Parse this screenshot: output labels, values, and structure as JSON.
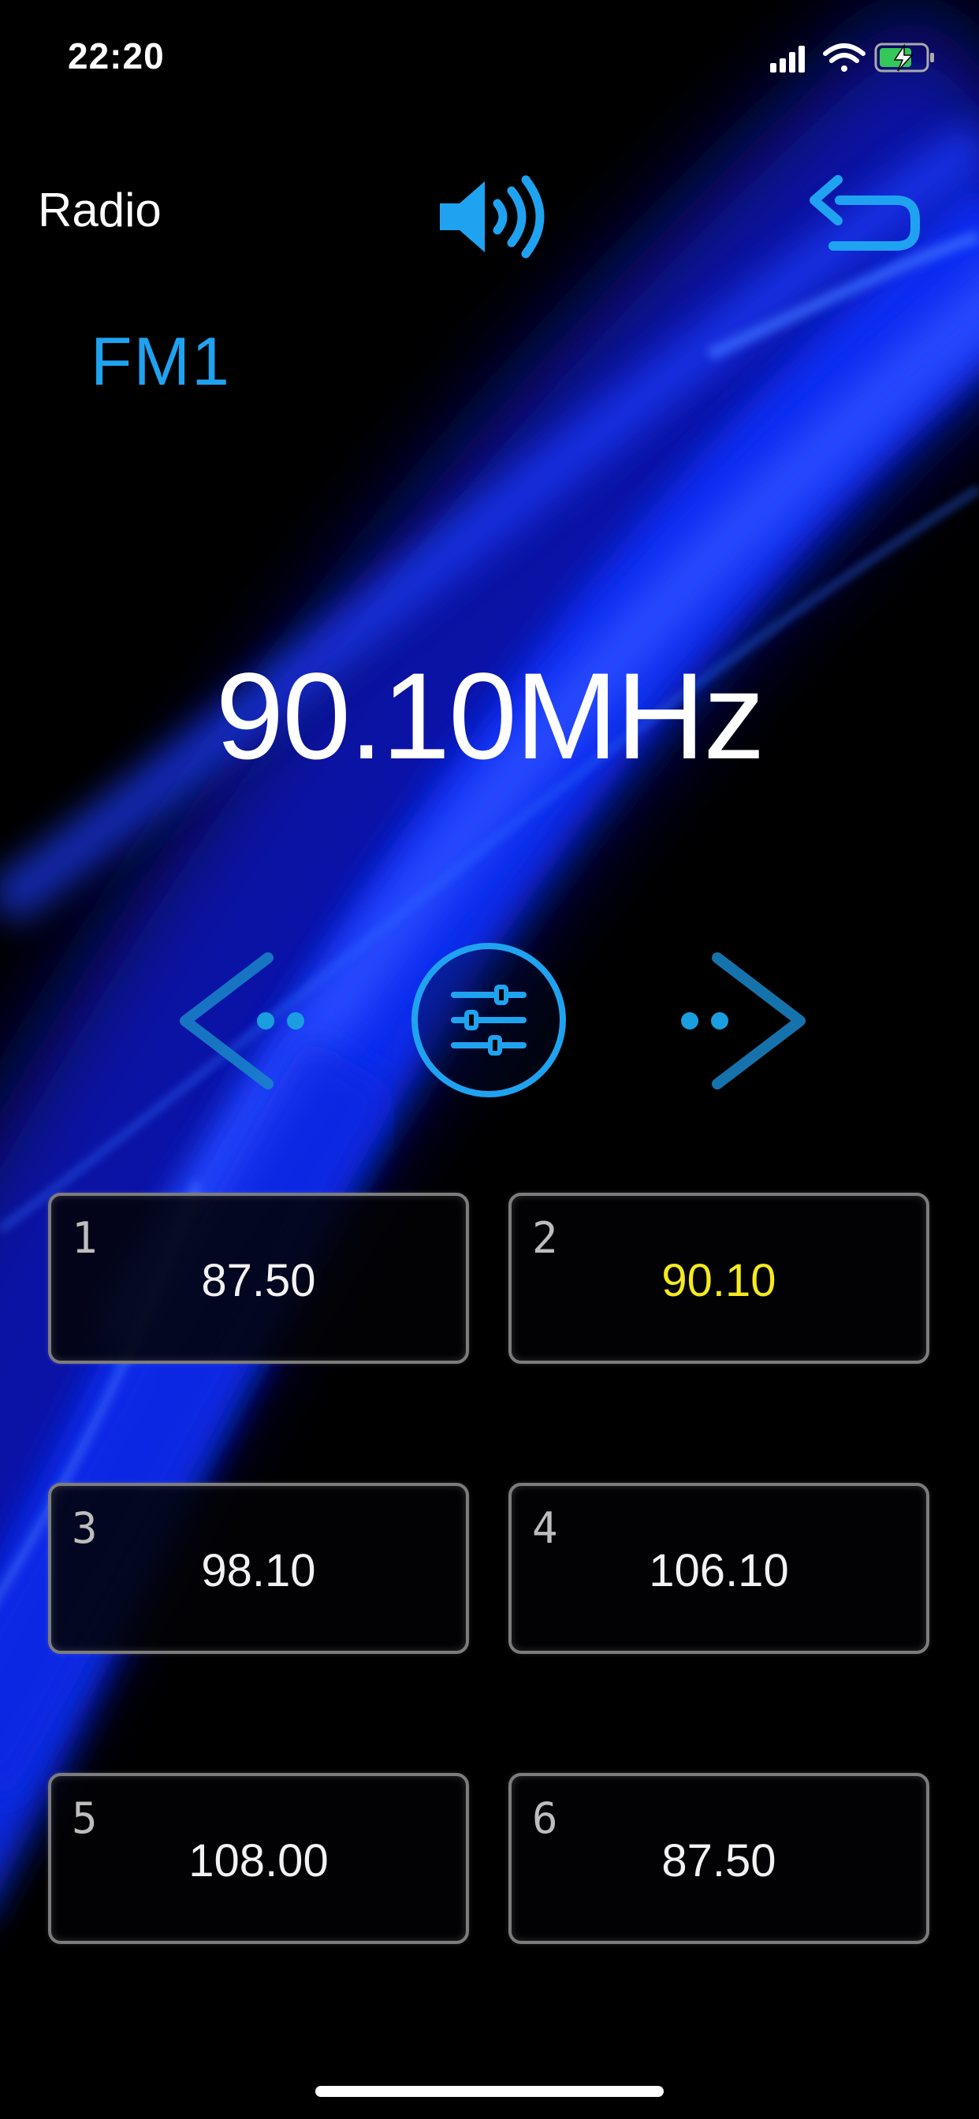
{
  "status_bar": {
    "time": "22:20"
  },
  "header": {
    "title": "Radio"
  },
  "tuner": {
    "band": "FM1",
    "frequency": "90.10MHz"
  },
  "presets": [
    {
      "number": "1",
      "frequency": "87.50",
      "active": false
    },
    {
      "number": "2",
      "frequency": "90.10",
      "active": true
    },
    {
      "number": "3",
      "frequency": "98.10",
      "active": false
    },
    {
      "number": "4",
      "frequency": "106.10",
      "active": false
    },
    {
      "number": "5",
      "frequency": "108.00",
      "active": false
    },
    {
      "number": "6",
      "frequency": "87.50",
      "active": false
    }
  ],
  "colors": {
    "accent": "#1fa3f0",
    "active_preset": "#f4ea1d",
    "background": "#000000"
  },
  "icons": {
    "volume": "speaker-icon",
    "back": "return-arrow-icon",
    "seek_back": "seek-back-icon",
    "settings": "equalizer-settings-icon",
    "seek_forward": "seek-forward-icon"
  }
}
